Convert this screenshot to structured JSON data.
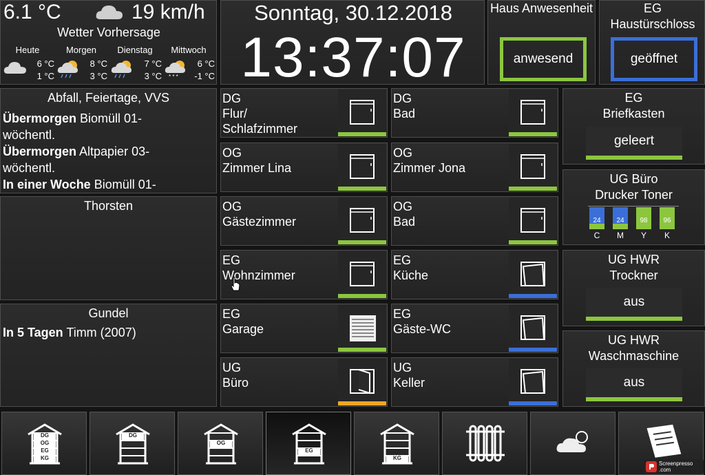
{
  "weather": {
    "temperature": "6.1 °C",
    "wind": "19 km/h",
    "title": "Wetter Vorhersage",
    "forecast": [
      {
        "day": "Heute",
        "high": "6 °C",
        "low": "1 °C",
        "icon": "cloudy-icon"
      },
      {
        "day": "Morgen",
        "high": "8 °C",
        "low": "3 °C",
        "icon": "sun-rain-icon"
      },
      {
        "day": "Dienstag",
        "high": "7 °C",
        "low": "3 °C",
        "icon": "sun-rain-icon"
      },
      {
        "day": "Mittwoch",
        "high": "6 °C",
        "low": "-1 °C",
        "icon": "snow-sun-icon"
      }
    ]
  },
  "clock": {
    "date": "Sonntag, 30.12.2018",
    "time": "13:37:07"
  },
  "presence": {
    "title": "Haus Anwesenheit",
    "value": "anwesend",
    "color": "#8cc63f"
  },
  "lock": {
    "title": "EG Haustürschloss",
    "value": "geöffnet",
    "color": "#3b6fd8"
  },
  "waste": {
    "title": "Abfall, Feiertage, VVS",
    "entries": [
      {
        "when": "Übermorgen",
        "what": " Biomüll 01-wöchentl."
      },
      {
        "when": "Übermorgen",
        "what": " Altpapier 03-wöchentl."
      },
      {
        "when": "In einer Woche",
        "what": " Biomüll 01-"
      }
    ]
  },
  "thorsten": {
    "title": "Thorsten"
  },
  "gundel": {
    "title": "Gundel",
    "when": "In 5 Tagen",
    "what": " Timm (2007)"
  },
  "rooms": {
    "r1": {
      "floor": "DG",
      "name": "Flur/\nSchlafzimmer",
      "icon": "window-closed-icon",
      "bar": "#8cc63f"
    },
    "r2": {
      "floor": "DG",
      "name": "Bad",
      "icon": "window-closed-icon",
      "bar": "#8cc63f"
    },
    "r3": {
      "floor": "OG",
      "name": "Zimmer Lina",
      "icon": "window-closed-icon",
      "bar": "#8cc63f"
    },
    "r4": {
      "floor": "OG",
      "name": "Zimmer Jona",
      "icon": "window-closed-icon",
      "bar": "#8cc63f"
    },
    "r5": {
      "floor": "OG",
      "name": "Gästezimmer",
      "icon": "window-closed-icon",
      "bar": "#8cc63f"
    },
    "r6": {
      "floor": "OG",
      "name": "Bad",
      "icon": "window-closed-icon",
      "bar": "#8cc63f"
    },
    "r7": {
      "floor": "EG",
      "name": "Wohnzimmer",
      "icon": "window-closed-icon",
      "bar": "#8cc63f"
    },
    "r8": {
      "floor": "EG",
      "name": "Küche",
      "icon": "window-tilted-icon",
      "bar": "#3b6fd8"
    },
    "r9": {
      "floor": "EG",
      "name": "Garage",
      "icon": "garage-door-icon",
      "bar": "#8cc63f"
    },
    "r10": {
      "floor": "EG",
      "name": "Gäste-WC",
      "icon": "window-tilted-icon",
      "bar": "#3b6fd8"
    },
    "r11": {
      "floor": "UG",
      "name": "Büro",
      "icon": "window-open-icon",
      "bar": "#f5a623"
    },
    "r12": {
      "floor": "UG",
      "name": "Keller",
      "icon": "window-tilted-icon",
      "bar": "#3b6fd8"
    }
  },
  "mailbox": {
    "title": "EG\nBriefkasten",
    "value": "geleert"
  },
  "toner": {
    "title": "UG Büro\nDrucker Toner",
    "items": [
      {
        "label": "C",
        "level": 24,
        "color": "#3b6fd8"
      },
      {
        "label": "M",
        "level": 24,
        "color": "#3b6fd8"
      },
      {
        "label": "Y",
        "level": 98,
        "color": "#8cc63f"
      },
      {
        "label": "K",
        "level": 96,
        "color": "#8cc63f"
      }
    ]
  },
  "dryer": {
    "title": "UG HWR\nTrockner",
    "value": "aus"
  },
  "washer": {
    "title": "UG HWR\nWaschmaschine",
    "value": "aus"
  },
  "nav": [
    {
      "name": "nav-house-all",
      "labels": [
        "DG",
        "OG",
        "EG",
        "KG"
      ]
    },
    {
      "name": "nav-house-dg",
      "labels": [
        "DG"
      ]
    },
    {
      "name": "nav-house-og",
      "labels": [
        "OG"
      ]
    },
    {
      "name": "nav-house-eg",
      "labels": [
        "EG"
      ]
    },
    {
      "name": "nav-house-kg",
      "labels": [
        "KG"
      ]
    },
    {
      "name": "nav-heating",
      "labels": []
    },
    {
      "name": "nav-weather",
      "labels": []
    },
    {
      "name": "nav-notes",
      "labels": []
    }
  ],
  "watermark": "Screenpresso .com"
}
